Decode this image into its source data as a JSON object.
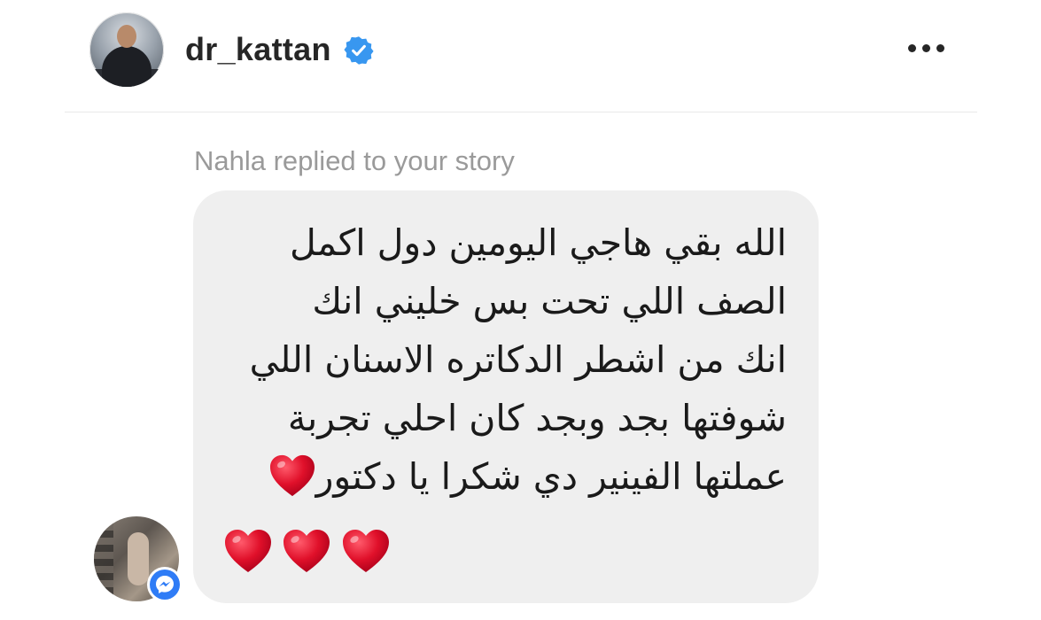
{
  "header": {
    "username": "dr_kattan",
    "verified_icon": "verified-badge-icon",
    "more_icon": "more-options-icon"
  },
  "thread": {
    "reply_label": "Nahla replied to your story",
    "message_lines": [
      "الله بقي هاجي اليومين دول اكمل",
      "الصف اللي تحت بس خليني انك",
      "انك من اشطر الدكاتره الاسنان اللي",
      "شوفتها بجد وبجد كان احلي تجربة",
      "عملتها الفينير دي شكرا يا دكتور"
    ],
    "heart_emoji": "❤️",
    "trailing_hearts_count": 3,
    "sender_badge_icon": "messenger-icon"
  },
  "colors": {
    "bubble": "#efefef",
    "verified": "#3897f0",
    "heart": "#e0102a",
    "label": "#9a9a9a"
  }
}
